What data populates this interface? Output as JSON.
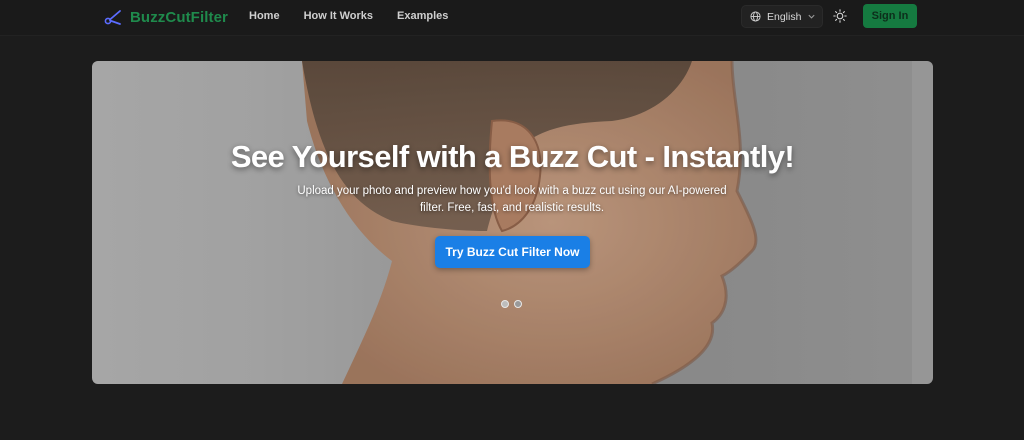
{
  "header": {
    "brand": "BuzzCutFilter",
    "brand_color": "#1f8a4c",
    "nav": [
      {
        "label": "Home"
      },
      {
        "label": "How It Works"
      },
      {
        "label": "Examples"
      }
    ],
    "language": "English",
    "theme_icon": "sun-icon",
    "signin_label": "Sign In"
  },
  "hero": {
    "title": "See Yourself with a Buzz Cut - Instantly!",
    "subtitle": "Upload your photo and preview how you'd look with a buzz cut using our AI-powered filter. Free, fast, and realistic results.",
    "cta_label": "Try Buzz Cut Filter Now",
    "cta_color": "#1a7fe6",
    "slides_total": 2,
    "active_slide": 1
  }
}
